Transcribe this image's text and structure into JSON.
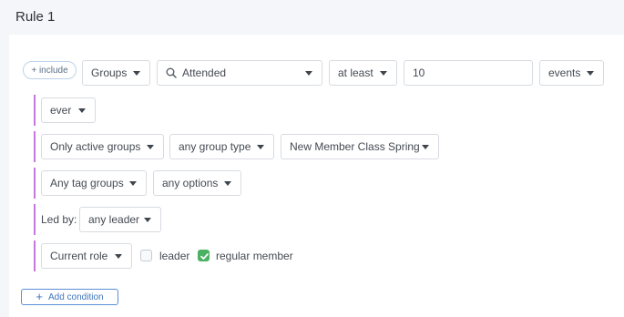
{
  "rule": {
    "title": "Rule 1"
  },
  "criteria": {
    "include_label": "+ include",
    "type_select": "Groups",
    "action_select": "Attended",
    "comparator_select": "at least",
    "count_value": "10",
    "unit_select": "events"
  },
  "timeframe": {
    "select": "ever"
  },
  "group_filter": {
    "status_select": "Only active groups",
    "type_select": "any group type",
    "group_select": "New Member Class Spring"
  },
  "tag_filter": {
    "tag_groups_select": "Any tag groups",
    "options_select": "any options"
  },
  "leader_filter": {
    "label": "Led by:",
    "select": "any leader"
  },
  "role_filter": {
    "select": "Current role",
    "leader_label": "leader",
    "leader_checked": false,
    "member_label": "regular member",
    "member_checked": true
  },
  "footer": {
    "add_condition_label": "Add condition"
  },
  "colors": {
    "branch_line": "#c678dc",
    "check_green": "#4cb263",
    "link_blue": "#3f74bf"
  }
}
